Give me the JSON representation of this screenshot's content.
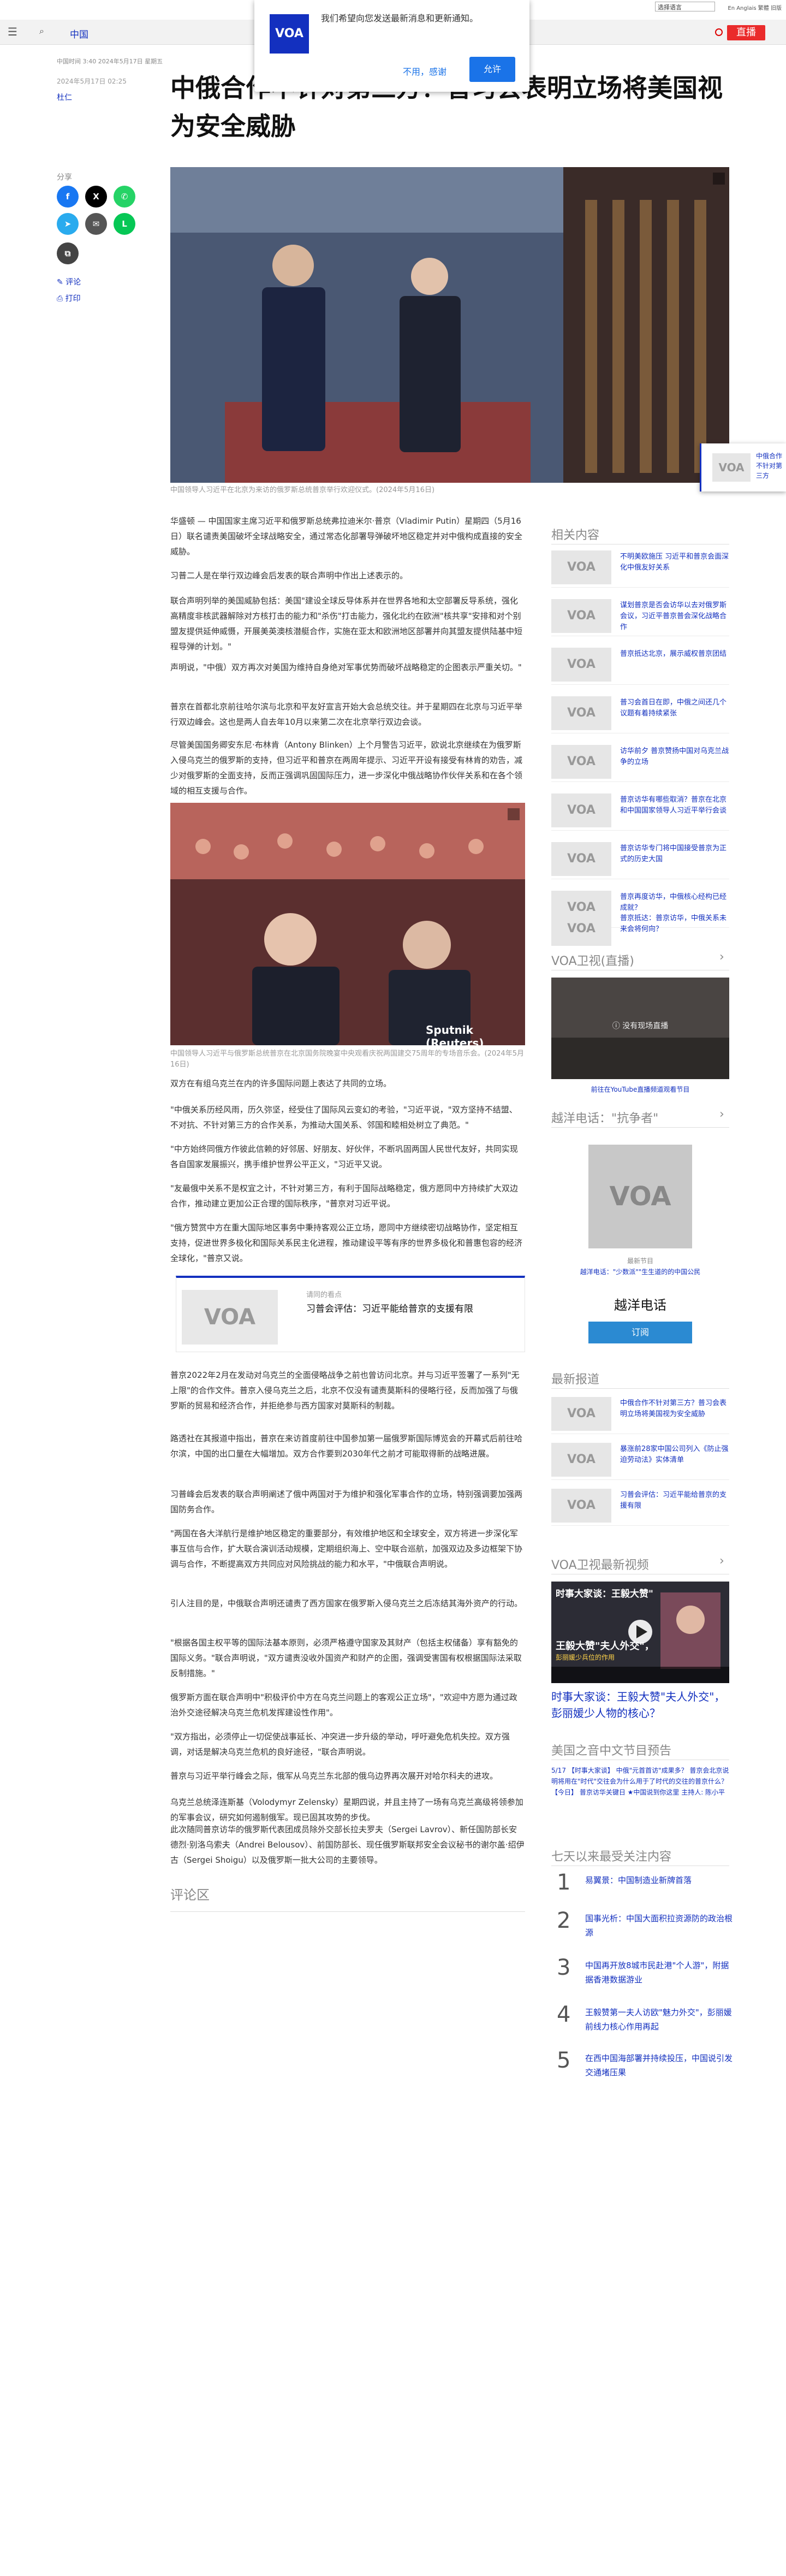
{
  "topbar": {
    "language": "选择语言",
    "misc": "En Anglais 繁體 旧版"
  },
  "nav": {
    "section": "中国",
    "live_label": "直播"
  },
  "notification": {
    "logo": "VOA",
    "message": "我们希望向您发送最新消息和更新通知。",
    "decline": "不用，感谢",
    "accept": "允许"
  },
  "article": {
    "breadcrumb_date": "中国时间 3:40 2024年5月17日 星期五",
    "pubdate": "2024年5月17日 02:25",
    "author": "杜仁",
    "headline": "中俄合作不针对第三方？普习会表明立场将美国视为安全威胁",
    "share_label": "分享",
    "comment_link": "评论",
    "print_link": "打印",
    "figure1_caption": "中国领导人习近平在北京为来访的俄罗斯总统普京举行欢迎仪式。(2024年5月16日)",
    "paragraphs_a": [
      "华盛顿 — 中国国家主席习近平和俄罗斯总统弗拉迪米尔·普京（Vladimir Putin）星期四（5月16日）联名谴责美国破坏全球战略安全，通过常态化部署导弹破坏地区稳定并对中俄构成直接的安全威胁。",
      "习普二人是在举行双边峰会后发表的联合声明中作出上述表示的。",
      "联合声明列举的美国威胁包括：美国\"建设全球反导体系并在世界各地和太空部署反导系统，强化高精度非核武器解除对方核打击的能力和\"杀伤\"打击能力，强化北约在欧洲\"核共享\"安排和对个别盟友提供延伸威慑，开展美英澳核潜艇合作，实施在亚太和欧洲地区部署并向其盟友提供陆基中短程导弹的计划。\"",
      "声明说，\"中俄）双方再次对美国为维持自身绝对军事优势而破坏战略稳定的企图表示严重关切。\"",
      "普京在首都北京前往哈尔滨与北京和平友好宣言开始大会总统交往。并于星期四在北京与习近平举行双边峰会。这也是两人自去年10月以来第二次在北京举行双边会谈。",
      "尽管美国国务卿安东尼·布林肯（Antony Blinken）上个月警告习近平，欧说北京继续在为俄罗斯入侵乌克兰的俄罗斯的支持，但习近平和普京在两周年提示、习近平开设有接受有林肯的劝告，减少对俄罗斯的全面支持，反而正强调巩固国际压力，进一步深化中俄战略协作伙伴关系和在各个领域的相互支援与合作。"
    ],
    "figure2_caption": "中国领导人习近平与俄罗斯总统普京在北京国务院晚宴中央观看庆祝两国建交75周年的专场音乐会。(2024年5月16日)",
    "figure2_watermark": "Sputnik (Reuters)",
    "paragraphs_b": [
      "双方在有组乌克兰在内的许多国际问题上表达了共同的立场。",
      "\"中俄关系历经风雨，历久弥坚，经受住了国际风云变幻的考验，\"习近平说，\"双方坚持不结盟、不对抗、不针对第三方的合作关系，为推动大国关系、邻国和睦相处树立了典范。\"",
      "\"中方始终同俄方作彼此信赖的好邻居、好朋友、好伙伴，不断巩固两国人民世代友好，共同实现各自国家发展振兴，携手维护世界公平正义，\"习近平又说。",
      "\"友最俄中关系不是权宜之计，不针对第三方，有利于国际战略稳定，俄方愿同中方持续扩大双边合作，推动建立更加公正合理的国际秩序，\"普京对习近平说。",
      "\"俄方赞赏中方在重大国际地区事务中秉持客观公正立场，愿同中方继续密切战略协作，坚定相互支持，促进世界多极化和国际关系民主化进程，推动建设平等有序的世界多极化和普惠包容的经济全球化，\"普京又说。"
    ],
    "related_card": {
      "kicker": "请同的看点",
      "title": "习普会评估：习近平能给普京的支援有限"
    },
    "paragraphs_c": [
      "普京2022年2月在发动对乌克兰的全面侵略战争之前也曾访问北京。并与习近平签署了一系列\"无上限\"的合作文件。普京入侵乌克兰之后，北京不仅没有谴责莫斯科的侵略行径，反而加强了与俄罗斯的贸易和经济合作，并拒绝参与西方国家对莫斯科的制裁。",
      "路透社在其报道中指出，普京在来访首度前往中国参加第一届俄罗斯国际博览会的开幕式后前往哈尔滨，中国的出口量在大幅增加。双方合作要到2030年代之前才可能取得新的战略进展。",
      "习普峰会后发表的联合声明阐述了俄中两国对于为维护和强化军事合作的立场，特别强调要加强两国防务合作。",
      "\"两国在各大洋航行是维护地区稳定的重要部分，有效维护地区和全球安全，双方将进一步深化军事互信与合作，扩大联合演训活动规模，定期组织海上、空中联合巡航，加强双边及多边框架下协调与合作，不断提高双方共同应对风险挑战的能力和水平，\"中俄联合声明说。",
      "引人注目的是，中俄联合声明还谴责了西方国家在俄罗斯入侵乌克兰之后冻结其海外资产的行动。",
      "\"根据各国主权平等的国际法基本原则，必须严格遵守国家及其财产（包括主权储备）享有豁免的国际义务。\"联合声明说，\"双方谴责没收外国资产和财产的企图，强调受害国有权根据国际法采取反制措施。\"",
      "俄罗斯方面在联合声明中\"积极评价中方在乌克兰问题上的客观公正立场\"，\"欢迎中方愿为通过政治外交途径解决乌克兰危机发挥建设性作用\"。",
      "\"双方指出，必须停止一切促使战事延长、冲突进一步升级的举动，呼吁避免危机失控。双方强调，对话是解决乌克兰危机的良好途径，\"联合声明说。",
      "普京与习近平举行峰会之际，俄军从乌克兰东北部的俄乌边界再次展开对哈尔科夫的进攻。",
      "乌克兰总统泽连斯基（Volodymyr Zelensky）星期四说，并且主持了一场有乌克兰高级将领参加的军事会议，研究如何遏制俄军。现已固其攻势的步伐。",
      "此次随同普京访华的俄罗斯代表团成员除外交部长拉夫罗夫（Sergei Lavrov）、新任国防部长安德烈·别洛乌索夫（Andrei Belousov）、前国防部长、现任俄罗斯联邦安全会议秘书的谢尔盖·绍伊古（Sergei Shoigu）以及俄罗斯一批大公司的主要领导。"
    ],
    "comments_heading": "评论区"
  },
  "sidebar": {
    "related_heading": "相关内容",
    "related": [
      "不明美欧施压 习近平和普京会面深化中俄友好关系",
      "谋划普京是否会访华以去对俄罗斯会议，习近平普京普会深化战略合作",
      "普京抵达北京，展示威权普京团结",
      "普习会首日在即，中俄之间还几个议题有着持续紧张",
      "访华前夕 普京赞扬中国对乌克兰战争的立场",
      "普京访华有哪些取消？普京在北京和中国国家领导人习近平举行会谈",
      "普京访华专门将中国接受普京为正式的历史大国",
      "普京再度访华，中俄核心经构已经成就？",
      "普京抵达：普京访华，中俄关系未来会将何向？"
    ],
    "live_heading": "VOA卫视(直播)",
    "live_msg": "没有现场直播",
    "yt_link": "前往在YouTube直播频道观看节目",
    "podcast_heading": "越洋电话：\"抗争者\"",
    "podcast_kicker": "最新节目",
    "podcast_desc": "越洋电话：\"少数派\"\"生生道的的中国公民",
    "podcast_title": "越洋电话",
    "podcast_subscribe": "订阅",
    "news_heading": "最新报道",
    "news": [
      "中俄合作不针对第三方？普习会表明立场将美国视为安全威胁",
      "暴涨前28家中国公司列入《防止强迫劳动法》实体清单",
      "习普会评估：习近平能给普京的支援有限"
    ],
    "video_heading": "VOA卫视最新视频",
    "video_overlay_a": "时事大家谈：王毅大赞\"",
    "video_overlay_b": "王毅大赞\"夫人外交\"，",
    "video_overlay_c": "彭丽媛少兵位的作用",
    "video_title": "时事大家谈：王毅大赞\"夫人外交\"，彭丽媛少人物的核心？",
    "schedule_heading": "美国之音中文节目预告",
    "schedule_text": "5/17 【时事大家谈】 中俄\"元首首访\"成果多？ 普京会北京说明将用在\"时代\"交往会为什么用于了时代的交往的普京什么？ 【今日】 普京访华关键日 ★中国说到你这里 主持人: 陈小平",
    "popular_heading": "七天以来最受关注内容",
    "popular": [
      "易翼景：中国制造业新牌首落",
      "国事光析：中国大面积拉资源防的政治根源",
      "中国再开放8城市民赴港\"个人游\"，附据据香港数据游业",
      "王毅赞第一夫人访欧\"魅力外交\"，彭丽媛前线力核心作用再起",
      "在西中国海部署并持续投压，中国说引发交通堵压果"
    ]
  },
  "float_card": {
    "logo": "VOA",
    "text": "中俄合作不针对第三方"
  },
  "logo_text": "VOA"
}
